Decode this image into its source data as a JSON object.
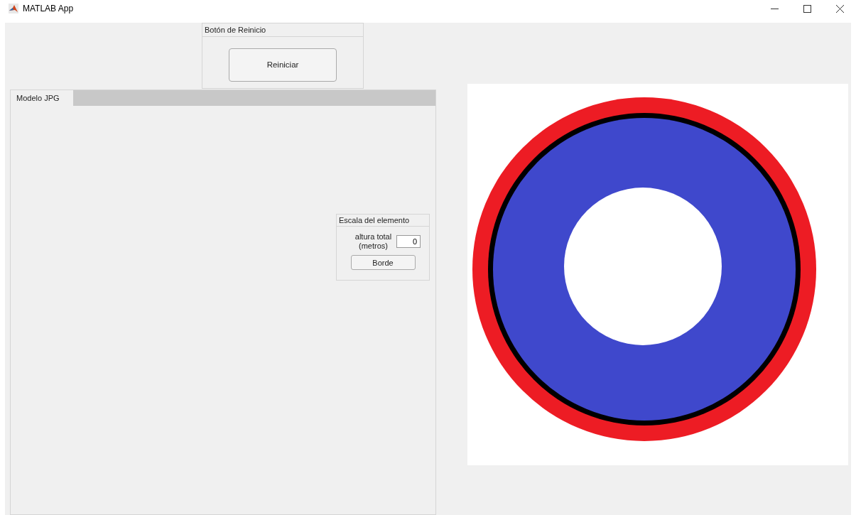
{
  "window": {
    "title": "MATLAB App"
  },
  "reset_panel": {
    "title": "Botón de Reinicio",
    "button": "Reiniciar"
  },
  "tabs": [
    {
      "label": "Modelo JPG",
      "selected": true
    }
  ],
  "scale_panel": {
    "title": "Escala del elemento",
    "field_label": [
      "altura total",
      "(metros)"
    ],
    "value": "0",
    "button": "Borde"
  }
}
